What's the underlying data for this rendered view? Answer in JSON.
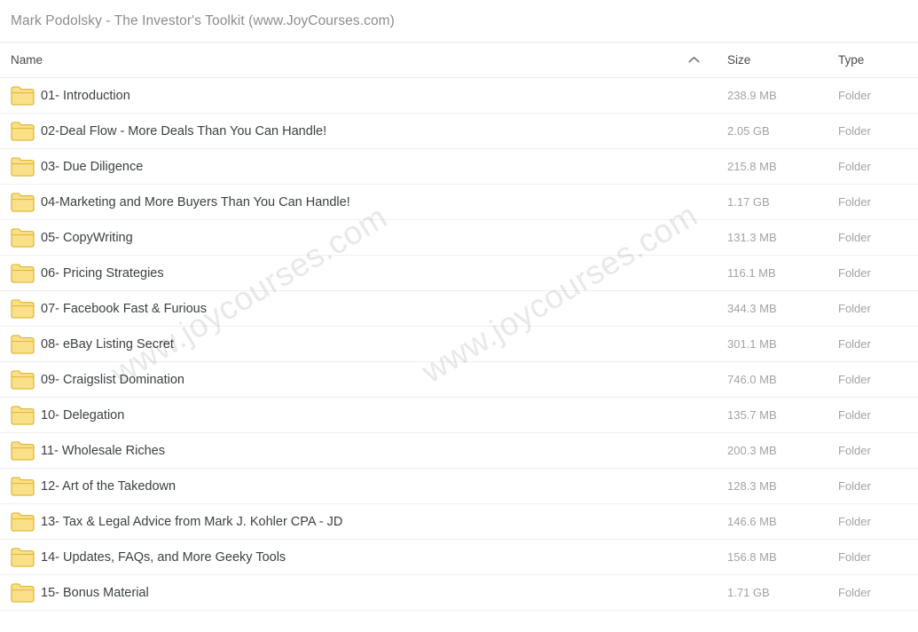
{
  "window": {
    "title": "Mark Podolsky - The Investor's Toolkit (www.JoyCourses.com)"
  },
  "table": {
    "columns": {
      "name": "Name",
      "size": "Size",
      "type": "Type"
    },
    "sort": {
      "column": "Name",
      "direction": "ascending",
      "icon": "chevron-up-icon"
    },
    "rows": [
      {
        "icon": "folder-icon",
        "name": "01- Introduction",
        "size": "238.9 MB",
        "type": "Folder"
      },
      {
        "icon": "folder-icon",
        "name": "02-Deal Flow - More Deals Than You Can Handle!",
        "size": "2.05 GB",
        "type": "Folder"
      },
      {
        "icon": "folder-icon",
        "name": "03- Due Diligence",
        "size": "215.8 MB",
        "type": "Folder"
      },
      {
        "icon": "folder-icon",
        "name": "04-Marketing and More Buyers Than You Can Handle!",
        "size": "1.17 GB",
        "type": "Folder"
      },
      {
        "icon": "folder-icon",
        "name": "05- CopyWriting",
        "size": "131.3 MB",
        "type": "Folder"
      },
      {
        "icon": "folder-icon",
        "name": "06- Pricing Strategies",
        "size": "116.1 MB",
        "type": "Folder"
      },
      {
        "icon": "folder-icon",
        "name": "07- Facebook Fast & Furious",
        "size": "344.3 MB",
        "type": "Folder"
      },
      {
        "icon": "folder-icon",
        "name": "08- eBay Listing Secret",
        "size": "301.1 MB",
        "type": "Folder"
      },
      {
        "icon": "folder-icon",
        "name": "09- Craigslist Domination",
        "size": "746.0 MB",
        "type": "Folder"
      },
      {
        "icon": "folder-icon",
        "name": "10- Delegation",
        "size": "135.7 MB",
        "type": "Folder"
      },
      {
        "icon": "folder-icon",
        "name": "11- Wholesale Riches",
        "size": "200.3 MB",
        "type": "Folder"
      },
      {
        "icon": "folder-icon",
        "name": "12- Art of the Takedown",
        "size": "128.3 MB",
        "type": "Folder"
      },
      {
        "icon": "folder-icon",
        "name": "13- Tax & Legal Advice from Mark J. Kohler CPA - JD",
        "size": "146.6 MB",
        "type": "Folder"
      },
      {
        "icon": "folder-icon",
        "name": "14- Updates, FAQs, and More Geeky Tools",
        "size": "156.8 MB",
        "type": "Folder"
      },
      {
        "icon": "folder-icon",
        "name": "15- Bonus Material",
        "size": "1.71 GB",
        "type": "Folder"
      }
    ]
  },
  "watermarks": [
    {
      "text": "www.joycourses.com"
    },
    {
      "text": "www.joycourses.com"
    }
  ],
  "colors": {
    "folder_fill": "#fbe08a",
    "folder_stroke": "#e0b93c",
    "title_text": "#8d8d8d",
    "row_text": "#3c4043",
    "meta_text": "#a3a3a3",
    "divider": "#f0f0f0"
  }
}
